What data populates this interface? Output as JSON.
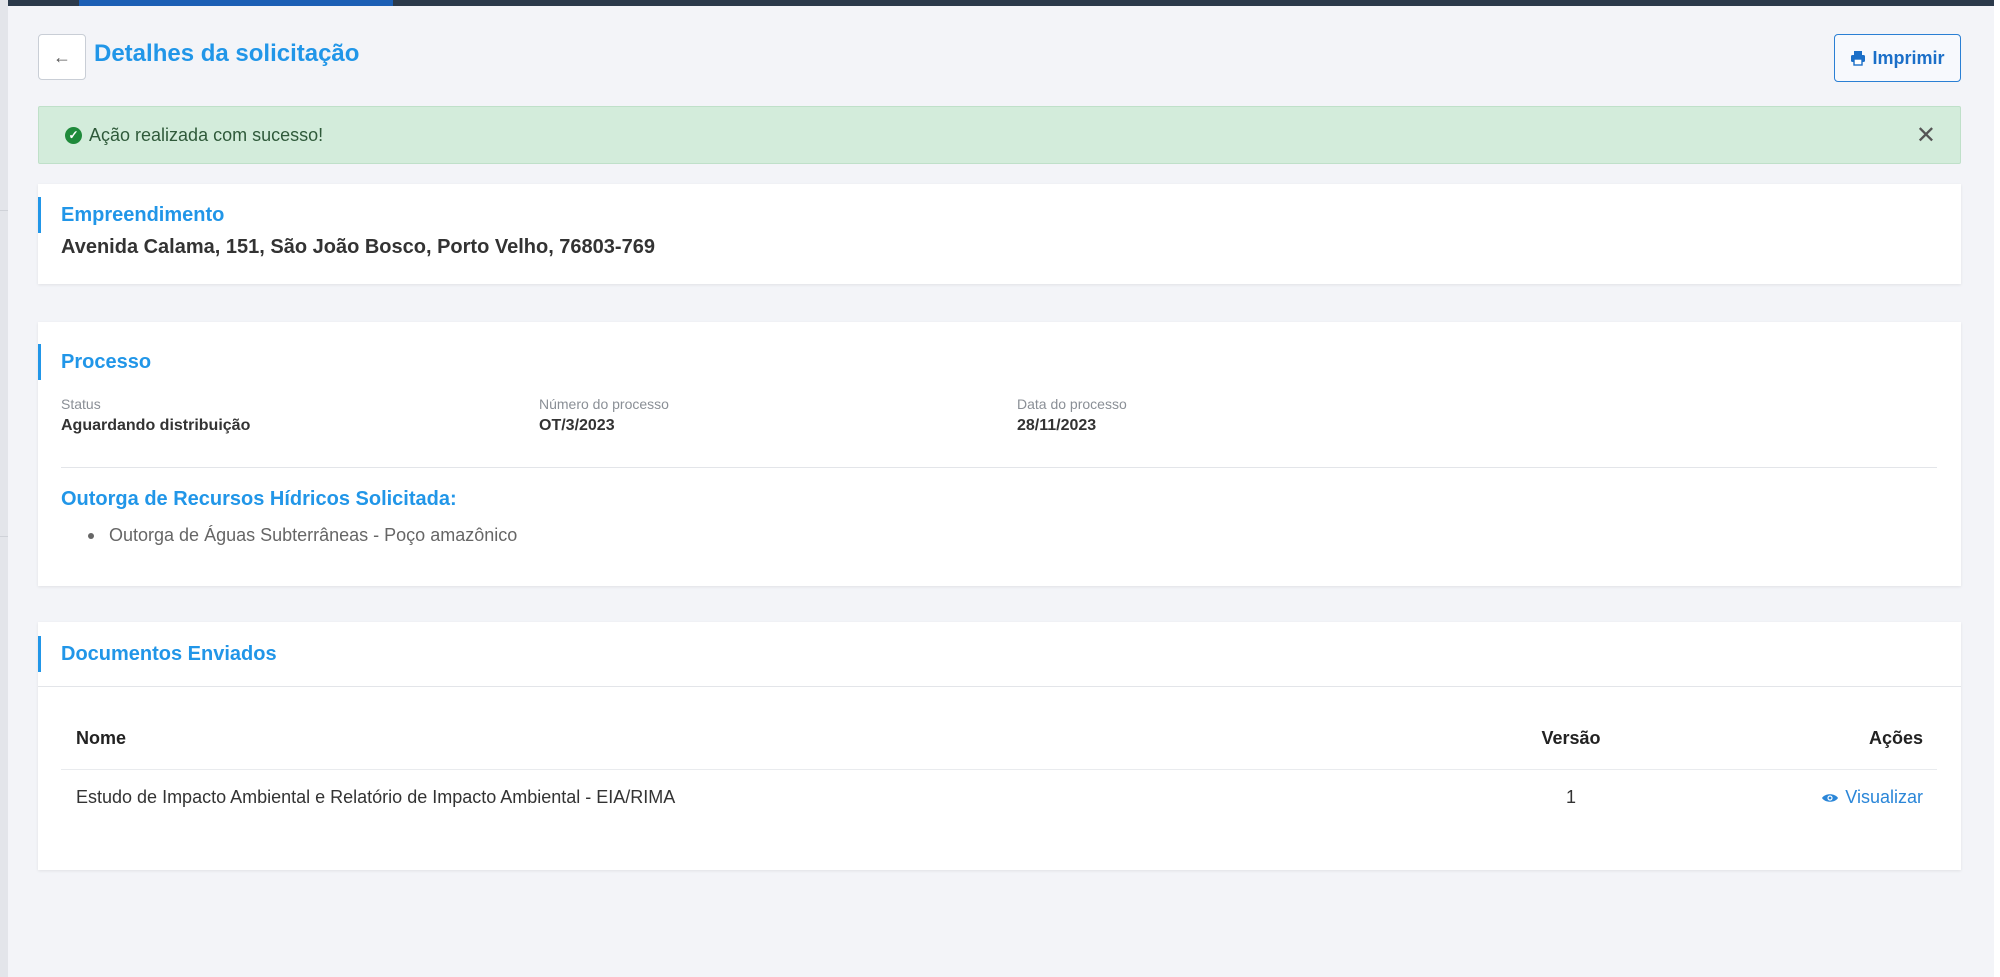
{
  "header": {
    "title": "Detalhes da solicitação",
    "back_icon": "arrow-left-icon",
    "print_label": "Imprimir",
    "print_icon": "printer-icon"
  },
  "alert": {
    "message": "Ação realizada com sucesso!",
    "icon": "check-circle-icon",
    "close_icon": "close-icon",
    "color": "#d3ecdb"
  },
  "empreendimento": {
    "title": "Empreendimento",
    "address": "Avenida Calama, 151, São João Bosco, Porto Velho, 76803-769"
  },
  "processo": {
    "title": "Processo",
    "fields": [
      {
        "label": "Status",
        "value": "Aguardando distribuição"
      },
      {
        "label": "Número do processo",
        "value": "OT/3/2023"
      },
      {
        "label": "Data do processo",
        "value": "28/11/2023"
      }
    ],
    "outorga_title": "Outorga de Recursos Hídricos Solicitada:",
    "outorga_items": [
      "Outorga de Águas Subterrâneas - Poço amazônico"
    ]
  },
  "documentos": {
    "title": "Documentos Enviados",
    "columns": [
      "Nome",
      "Versão",
      "Ações"
    ],
    "rows": [
      {
        "nome": "Estudo de Impacto Ambiental e Relatório de Impacto Ambiental - EIA/RIMA",
        "versao": "1",
        "acao_label": "Visualizar",
        "acao_icon": "eye-icon"
      }
    ]
  },
  "colors": {
    "accent": "#2196e8",
    "link": "#2a86d8",
    "topbar": "#2b3a4b",
    "topbar_active": "#1b5fb5",
    "success": "#1f8a3b"
  }
}
